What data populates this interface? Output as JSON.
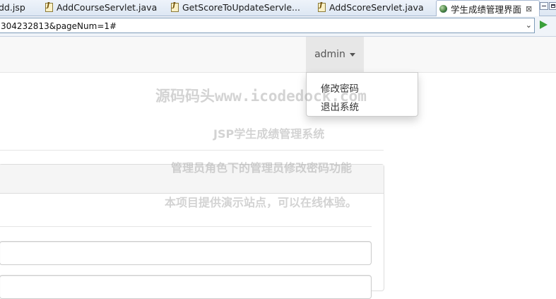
{
  "tabs": [
    {
      "label": "dd.jsp",
      "icon": "jsp-file-icon"
    },
    {
      "label": "AddCourseServlet.java",
      "icon": "java-file-icon"
    },
    {
      "label": "GetScoreToUpdateServle...",
      "icon": "java-file-icon"
    },
    {
      "label": "AddScoreServlet.java",
      "icon": "java-file-icon"
    },
    {
      "label": "学生成绩管理界面",
      "icon": "globe-icon",
      "active": true,
      "close": "⊠"
    }
  ],
  "address": {
    "url": "304232813&pageNum=1#"
  },
  "navbar": {
    "user_label": "admin"
  },
  "user_menu": {
    "items": [
      "修改密码",
      "退出系统"
    ]
  },
  "watermark": {
    "line1": "源码码头www.icodedock.com",
    "line2": "JSP学生成绩管理系统",
    "line3": "管理员角色下的管理员修改密码功能",
    "line4": "本项目提供演示站点，可以在线体验。"
  },
  "colors": {
    "navbar_bg": "#f8f8f8",
    "active_toggle_bg": "#e7e7e7",
    "go_button": "#3aa03a"
  }
}
